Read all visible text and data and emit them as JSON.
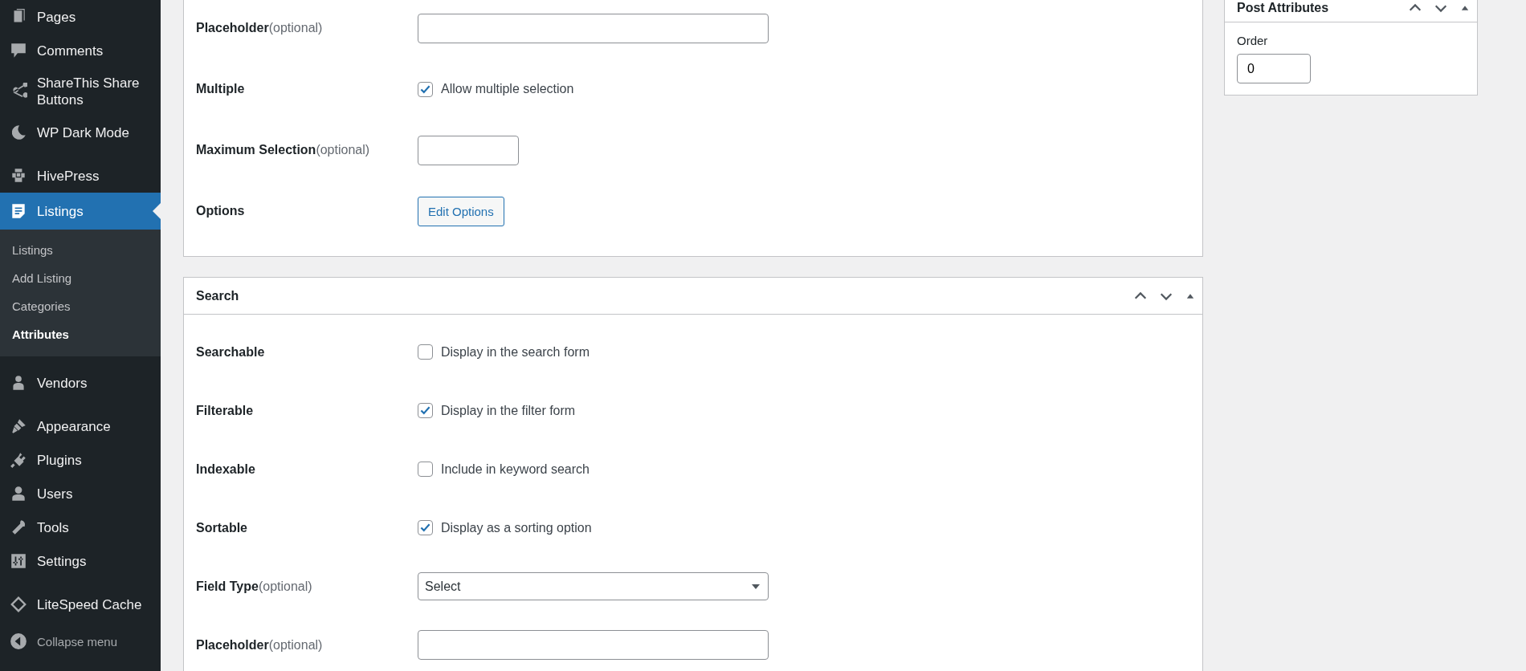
{
  "sidebar": {
    "menu": [
      {
        "label": "Pages",
        "selected": false
      },
      {
        "label": "Comments",
        "selected": false
      },
      {
        "label": "ShareThis Share Buttons",
        "selected": false
      },
      {
        "label": "WP Dark Mode",
        "selected": false
      },
      {
        "label": "HivePress",
        "selected": false
      },
      {
        "label": "Listings",
        "selected": true,
        "submenu": [
          {
            "label": "Listings",
            "selected": false
          },
          {
            "label": "Add Listing",
            "selected": false
          },
          {
            "label": "Categories",
            "selected": false
          },
          {
            "label": "Attributes",
            "selected": true
          }
        ]
      },
      {
        "label": "Vendors",
        "selected": false
      },
      {
        "label": "Appearance",
        "selected": false
      },
      {
        "label": "Plugins",
        "selected": false
      },
      {
        "label": "Users",
        "selected": false
      },
      {
        "label": "Tools",
        "selected": false
      },
      {
        "label": "Settings",
        "selected": false
      },
      {
        "label": "LiteSpeed Cache",
        "selected": false
      }
    ],
    "collapse": "Collapse menu"
  },
  "edit_panel": {
    "rows": [
      {
        "kind": "text",
        "label": "Placeholder",
        "hint": "(optional)"
      },
      {
        "kind": "checkbox",
        "label": "Multiple",
        "text": "Allow multiple selection",
        "checked": true
      },
      {
        "kind": "number",
        "label": "Maximum Selection",
        "hint": "(optional)"
      },
      {
        "kind": "button",
        "label": "Options",
        "text": "Edit Options"
      }
    ]
  },
  "search_panel": {
    "title": "Search",
    "rows": [
      {
        "kind": "checkbox",
        "label": "Searchable",
        "text": "Display in the search form",
        "checked": false
      },
      {
        "kind": "checkbox",
        "label": "Filterable",
        "text": "Display in the filter form",
        "checked": true
      },
      {
        "kind": "checkbox",
        "label": "Indexable",
        "text": "Include in keyword search",
        "checked": false
      },
      {
        "kind": "checkbox",
        "label": "Sortable",
        "text": "Display as a sorting option",
        "checked": true
      },
      {
        "kind": "select",
        "label": "Field Type",
        "hint": "(optional)",
        "value": "Select"
      },
      {
        "kind": "text",
        "label": "Placeholder",
        "hint": "(optional)"
      }
    ]
  },
  "post_attributes": {
    "title": "Post Attributes",
    "order_label": "Order",
    "order_value": "0"
  }
}
